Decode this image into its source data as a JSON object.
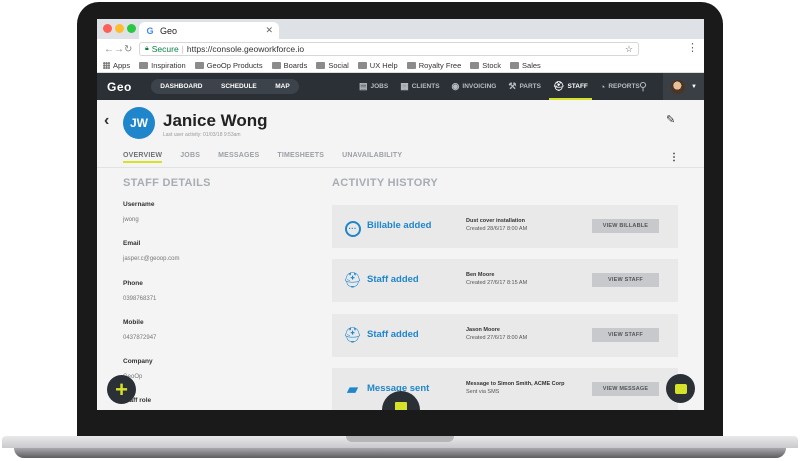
{
  "browser": {
    "tab_title": "Geo",
    "tab_favicon": "G",
    "secure_label": "Secure",
    "url": "https://console.geoworkforce.io",
    "bookmarks": [
      "Apps",
      "Inspiration",
      "GeoOp Products",
      "Boards",
      "Social",
      "UX Help",
      "Royalty Free",
      "Stock",
      "Sales"
    ]
  },
  "app": {
    "logo": "Geo",
    "pill_nav": [
      "DASHBOARD",
      "SCHEDULE",
      "MAP"
    ],
    "nav": [
      "JOBS",
      "CLIENTS",
      "INVOICING",
      "PARTS",
      "STAFF",
      "REPORTS"
    ],
    "active_nav": "STAFF",
    "accent_color": "#d6e12a",
    "brand_blue": "#1f86cc"
  },
  "profile": {
    "initials": "JW",
    "name": "Janice Wong",
    "last_activity": "Last user activity: 01/03/18 9:53am",
    "tabs": [
      "OVERVIEW",
      "JOBS",
      "MESSAGES",
      "TIMESHEETS",
      "UNAVAILABILITY"
    ]
  },
  "staff_details": {
    "heading": "STAFF DETAILS",
    "fields": [
      {
        "label": "Username",
        "value": "jwong"
      },
      {
        "label": "Email",
        "value": "jasper.c@geoop.com"
      },
      {
        "label": "Phone",
        "value": "0398768371"
      },
      {
        "label": "Mobile",
        "value": "0437872947"
      },
      {
        "label": "Company",
        "value": "GeoOp"
      },
      {
        "label": "Staff role",
        "value": ""
      }
    ]
  },
  "activity": {
    "heading": "ACTIVITY HISTORY",
    "items": [
      {
        "title": "Billable added",
        "detail": "Dust cover installation",
        "created": "Created 28/6/17 8:00 AM",
        "button": "VIEW BILLABLE",
        "icon": "dots-circle-icon"
      },
      {
        "title": "Staff added",
        "detail": "Ben Moore",
        "created": "Created 27/6/17 8:15 AM",
        "button": "VIEW STAFF",
        "icon": "hardhat-icon"
      },
      {
        "title": "Staff added",
        "detail": "Jason Moore",
        "created": "Created 27/6/17 8:00 AM",
        "button": "VIEW STAFF",
        "icon": "hardhat-icon"
      },
      {
        "title": "Message sent",
        "detail": "Message to Simon Smith, ACME Corp",
        "created": "Sent via SMS",
        "button": "VIEW MESSAGE",
        "icon": "message-icon"
      }
    ]
  }
}
